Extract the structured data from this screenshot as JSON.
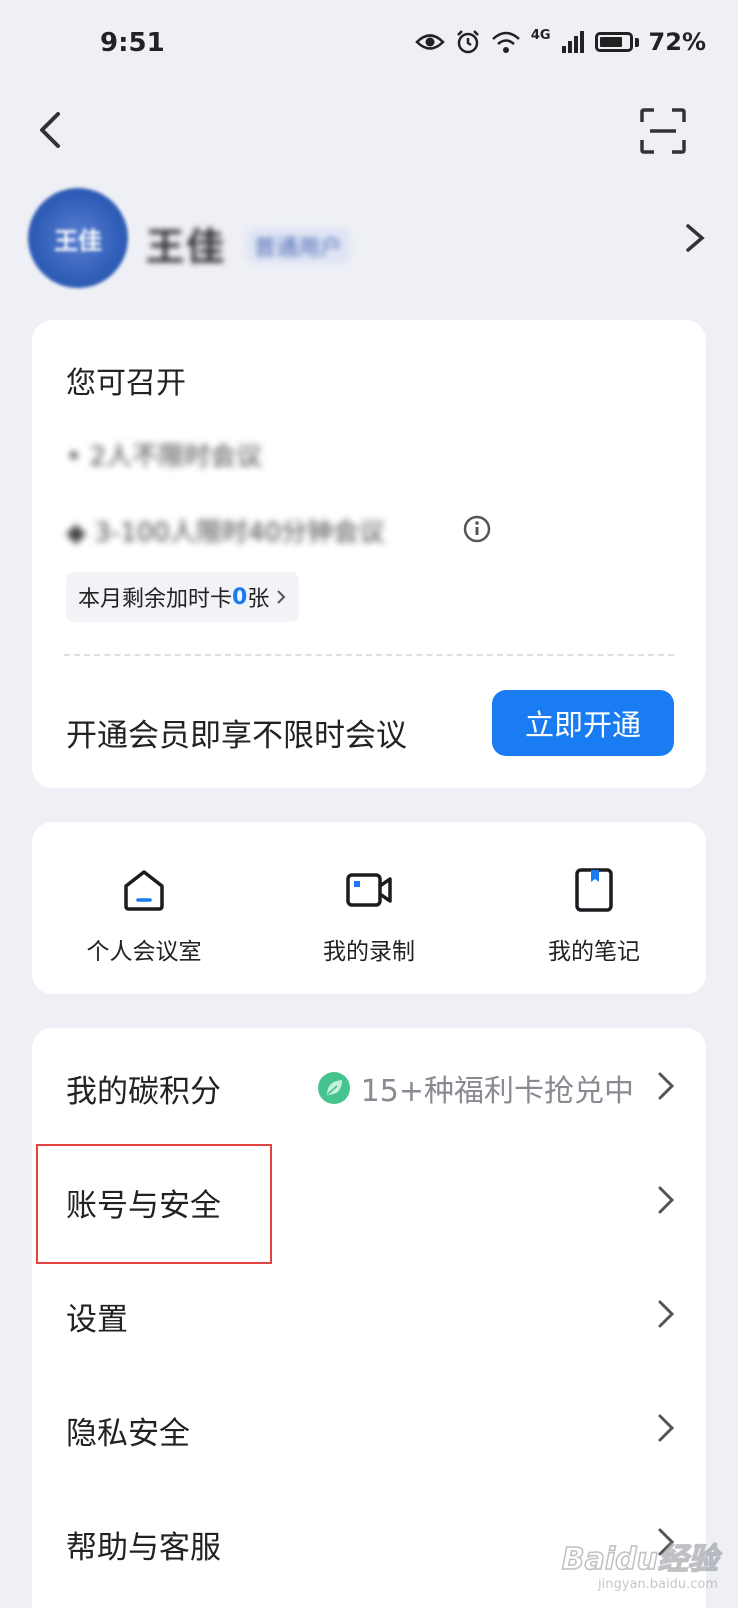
{
  "status": {
    "time": "9:51",
    "network": "4G",
    "battery": "72%"
  },
  "profile": {
    "username": "王佳",
    "tag": "普通用户",
    "avatar_text": "王佳"
  },
  "member_card": {
    "title": "您可召开",
    "benefits": [
      "2人不限时会议",
      "3-100人限时40分钟会议"
    ],
    "quota_prefix": "本月剩余加时卡",
    "quota_count": "0",
    "quota_suffix": "张",
    "vip_text": "开通会员即享不限时会议",
    "vip_button": "立即开通"
  },
  "quick": [
    {
      "label": "个人会议室",
      "icon": "home-icon"
    },
    {
      "label": "我的录制",
      "icon": "video-icon"
    },
    {
      "label": "我的笔记",
      "icon": "notebook-icon"
    }
  ],
  "list": [
    {
      "label": "我的碳积分",
      "extra": "15+种福利卡抢兑中"
    },
    {
      "label": "账号与安全"
    },
    {
      "label": "设置"
    },
    {
      "label": "隐私安全"
    },
    {
      "label": "帮助与客服"
    }
  ],
  "watermark": {
    "text": "Baidu经验",
    "sub": "jingyan.baidu.com"
  },
  "colors": {
    "accent": "#1a7cf3",
    "background": "#eef0f5",
    "highlight": "#e0463f",
    "leaf": "#45c48f"
  }
}
